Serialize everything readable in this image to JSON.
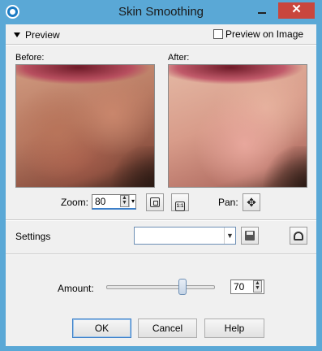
{
  "window": {
    "title": "Skin Smoothing",
    "minimize_glyph": "",
    "close_glyph": "✕"
  },
  "preview": {
    "header_label": "Preview",
    "preview_on_image_label": "Preview on Image",
    "preview_on_image_checked": false,
    "before_label": "Before:",
    "after_label": "After:",
    "zoom_label": "Zoom:",
    "zoom_value": "80",
    "pan_label": "Pan:",
    "fit_icon": "fit-to-window-icon",
    "actual_size_icon": "actual-size-icon",
    "pan_icon": "pan-move-icon",
    "pan_glyph": "✥"
  },
  "settings": {
    "label": "Settings",
    "preset_value": "",
    "save_icon": "save-preset-icon",
    "reset_icon": "reset-preset-icon"
  },
  "amount": {
    "label": "Amount:",
    "value": "70",
    "slider_fraction": 0.7
  },
  "buttons": {
    "ok": "OK",
    "cancel": "Cancel",
    "help": "Help"
  },
  "colors": {
    "titlebar": "#5aa8d6",
    "close": "#c9463d",
    "accent": "#3c7fc9"
  }
}
